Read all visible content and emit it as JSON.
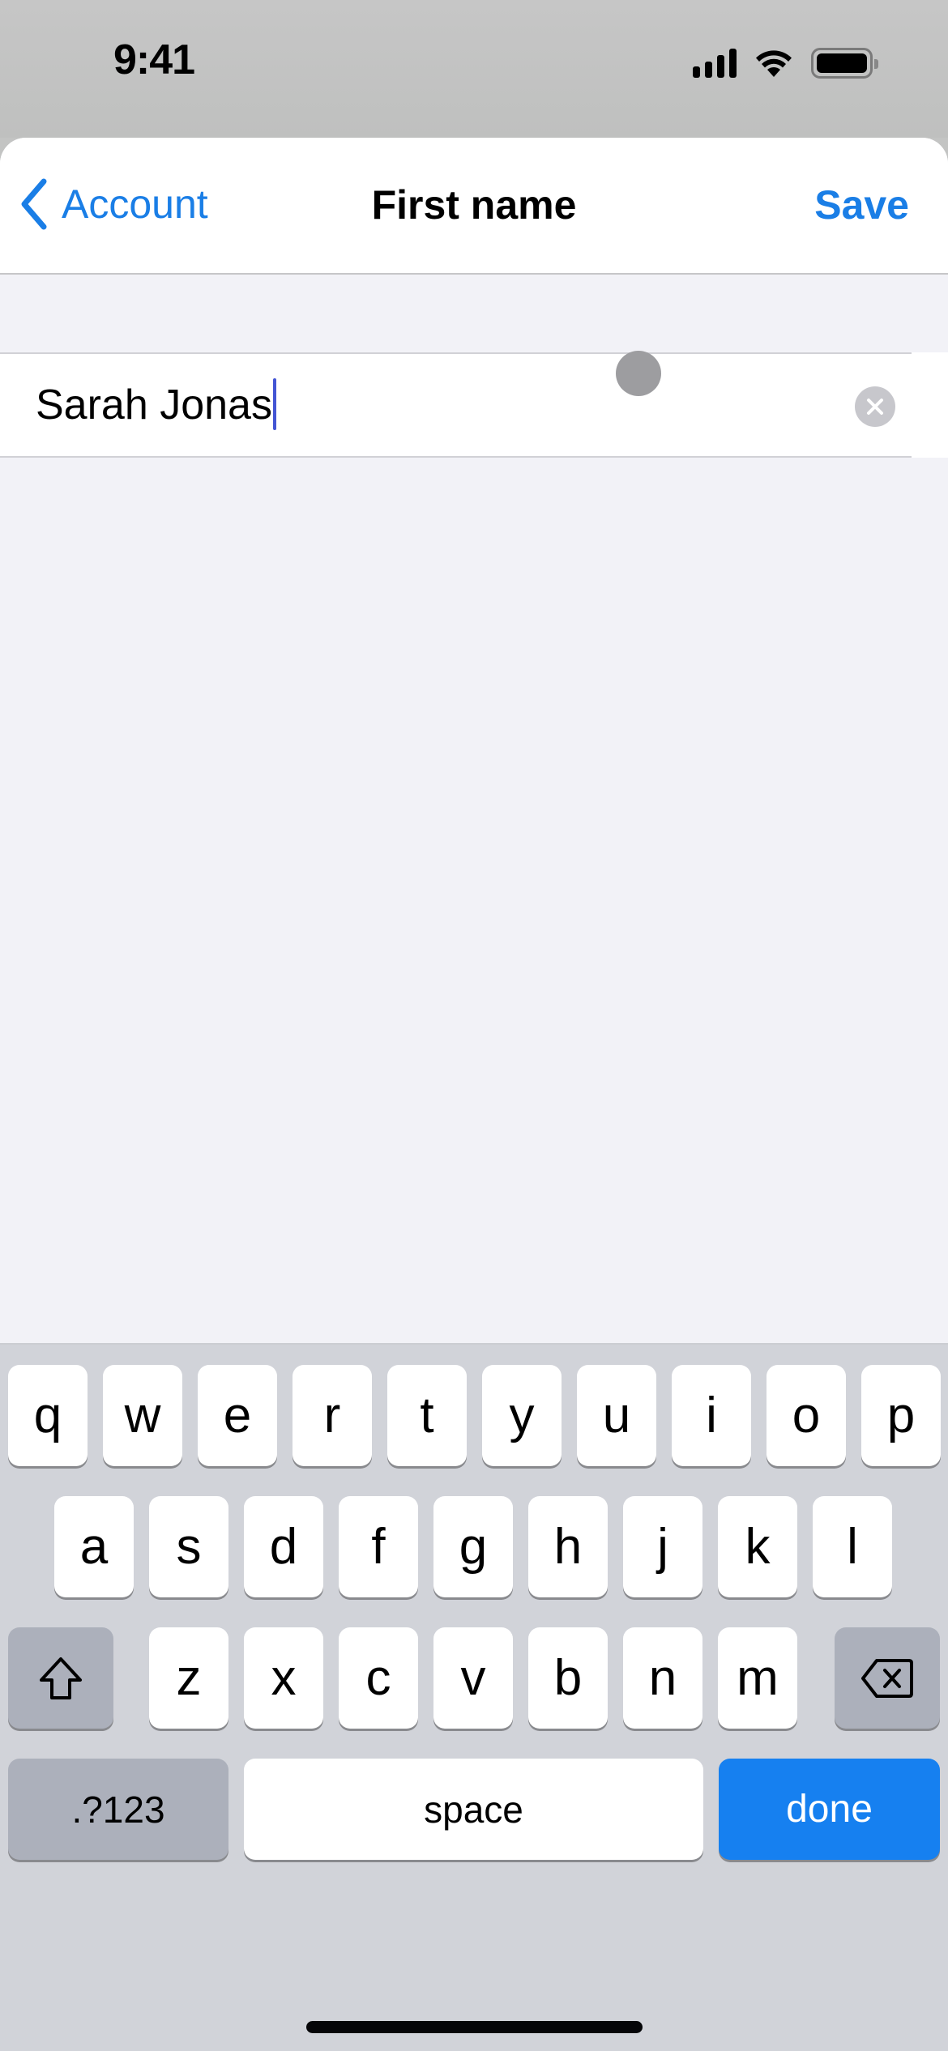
{
  "status_bar": {
    "time": "9:41",
    "icons": [
      "cellular-signal-icon",
      "wifi-icon",
      "battery-icon"
    ]
  },
  "nav": {
    "back_label": "Account",
    "back_icon": "chevron-left-icon",
    "title": "First name",
    "save_label": "Save"
  },
  "field": {
    "value": "Sarah Jonas",
    "clear_icon": "clear-circle-icon"
  },
  "keyboard": {
    "row1": [
      "q",
      "w",
      "e",
      "r",
      "t",
      "y",
      "u",
      "i",
      "o",
      "p"
    ],
    "row2": [
      "a",
      "s",
      "d",
      "f",
      "g",
      "h",
      "j",
      "k",
      "l"
    ],
    "row3": [
      "z",
      "x",
      "c",
      "v",
      "b",
      "n",
      "m"
    ],
    "shift_icon": "shift-icon",
    "delete_icon": "delete-backspace-icon",
    "numbers_label": ".?123",
    "space_label": "space",
    "done_label": "done"
  },
  "colors": {
    "accent": "#1a7ee6",
    "done_key": "#1680f0",
    "keyboard_bg": "#d1d3d9",
    "function_key": "#acb0bb",
    "caret": "#4355d4"
  }
}
